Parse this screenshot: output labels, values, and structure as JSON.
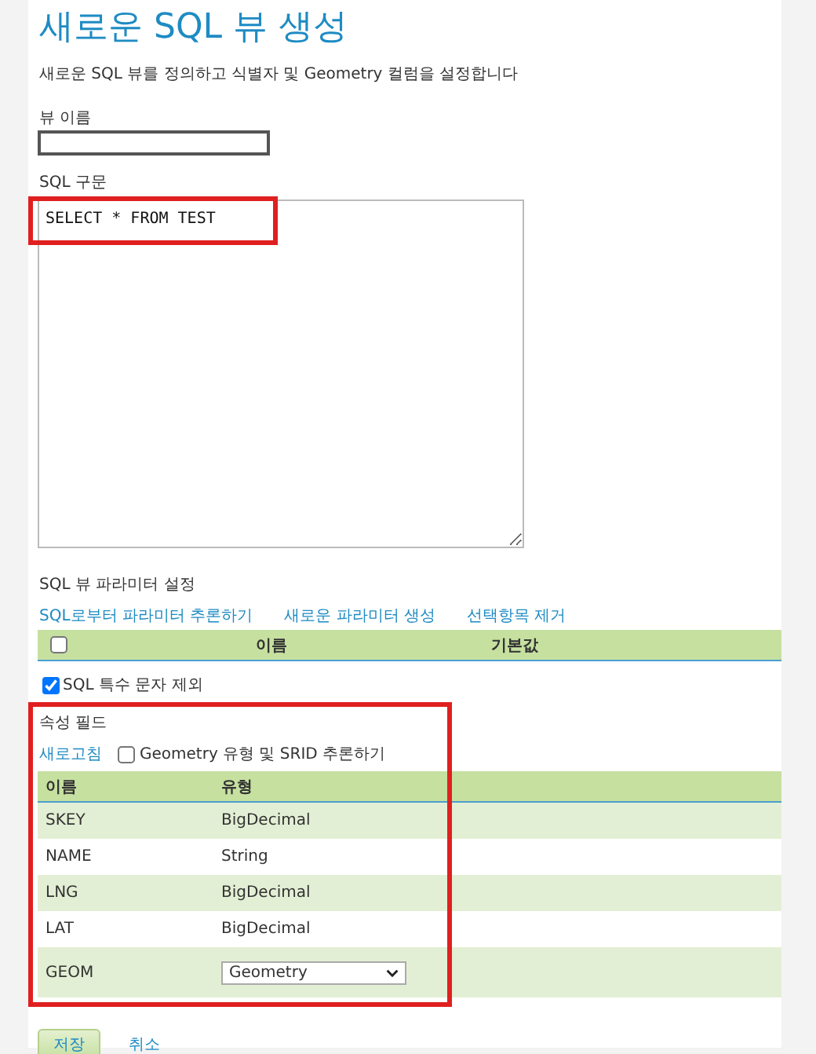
{
  "title": "새로운 SQL 뷰 생성",
  "description": "새로운 SQL 뷰를 정의하고 식별자 및 Geometry 컬럼을 설정합니다",
  "view_name": {
    "label": "뷰 이름"
  },
  "sql": {
    "label": "SQL 구문",
    "value": "SELECT * FROM TEST"
  },
  "parameters": {
    "label": "SQL 뷰 파라미터 설정",
    "links": [
      "SQL로부터 파라미터 추론하기",
      "새로운 파라미터 생성",
      "선택항목 제거"
    ],
    "select_all_checked": false,
    "columns": [
      "이름",
      "기본값"
    ],
    "escape_special": {
      "label": "SQL 특수 문자 제외",
      "checked": true
    }
  },
  "attributes": {
    "label": "속성 필드",
    "refresh": "새로고침",
    "guess": {
      "label": "Geometry 유형 및 SRID 추론하기",
      "checked": false
    },
    "columns": [
      "이름",
      "유형"
    ],
    "rows": [
      {
        "kind": "text",
        "name": "SKEY",
        "type": "BigDecimal"
      },
      {
        "kind": "text",
        "name": "NAME",
        "type": "String"
      },
      {
        "kind": "text",
        "name": "LNG",
        "type": "BigDecimal"
      },
      {
        "kind": "text",
        "name": "LAT",
        "type": "BigDecimal"
      },
      {
        "kind": "select",
        "name": "GEOM",
        "type": "Geometry"
      }
    ]
  },
  "buttons": {
    "save": "저장",
    "cancel": "취소"
  }
}
